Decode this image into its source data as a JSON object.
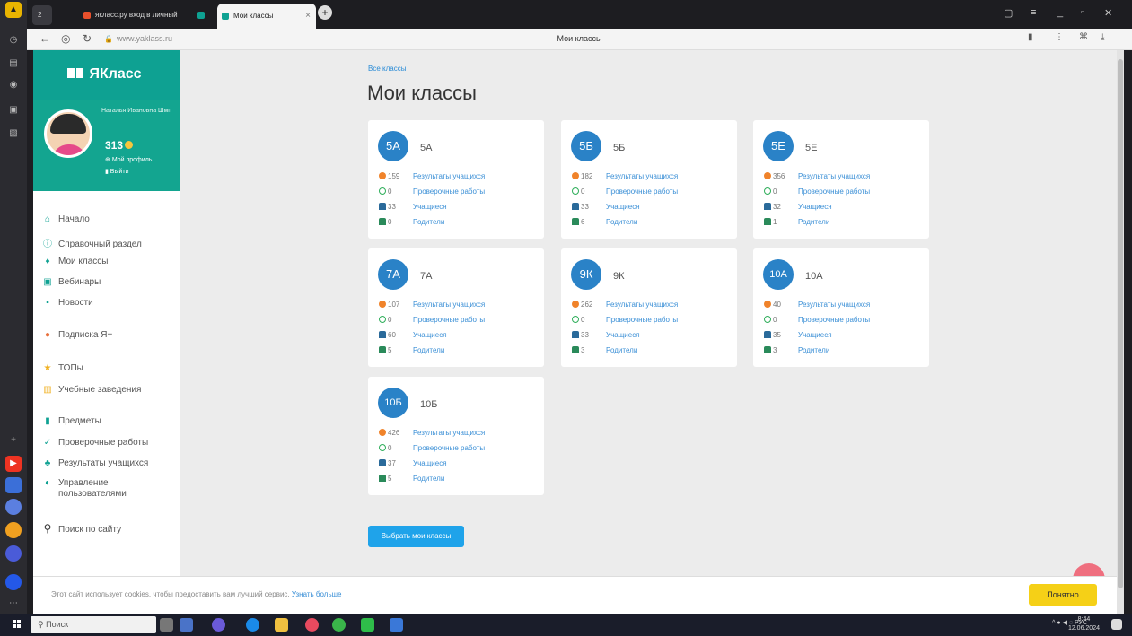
{
  "browser": {
    "tabs": [
      {
        "label": "якласс.ру вход в личный",
        "active": false
      },
      {
        "label": "Мои классы",
        "active": true
      }
    ],
    "url": "www.yaklass.ru",
    "page_title": "Мои классы"
  },
  "site": {
    "logo": "ЯКласс",
    "profile": {
      "name": "Наталья Ивановна Шмп",
      "points": "313",
      "my_profile": "Мой профиль",
      "logout": "Выйти"
    },
    "menu": [
      {
        "label": "Начало",
        "icon": "home-icon"
      },
      {
        "label": "Справочный раздел",
        "icon": "help-icon"
      },
      {
        "label": "Мои классы",
        "icon": "classes-icon"
      },
      {
        "label": "Вебинары",
        "icon": "webinar-icon"
      },
      {
        "label": "Новости",
        "icon": "news-icon"
      },
      {
        "label": "Подписка Я+",
        "icon": "subscription-icon"
      },
      {
        "label": "ТОПы",
        "icon": "star-icon"
      },
      {
        "label": "Учебные заведения",
        "icon": "school-icon"
      },
      {
        "label": "Предметы",
        "icon": "subjects-icon"
      },
      {
        "label": "Проверочные работы",
        "icon": "check-icon"
      },
      {
        "label": "Результаты учащихся",
        "icon": "results-icon"
      },
      {
        "label": "Управление пользователями",
        "icon": "users-icon"
      },
      {
        "label": "Поиск по сайту",
        "icon": "search-icon"
      }
    ]
  },
  "main": {
    "breadcrumb": "Все классы",
    "title": "Мои классы",
    "row_labels": {
      "results": "Результаты учащихся",
      "tests": "Проверочные работы",
      "students": "Учащиеся",
      "parents": "Родители"
    },
    "classes": [
      {
        "badge": "5А",
        "name": "5А",
        "results": "159",
        "tests": "0",
        "students": "33",
        "parents": "0"
      },
      {
        "badge": "5Б",
        "name": "5Б",
        "results": "182",
        "tests": "0",
        "students": "33",
        "parents": "6"
      },
      {
        "badge": "5Е",
        "name": "5Е",
        "results": "356",
        "tests": "0",
        "students": "32",
        "parents": "1"
      },
      {
        "badge": "7А",
        "name": "7А",
        "results": "107",
        "tests": "0",
        "students": "60",
        "parents": "5"
      },
      {
        "badge": "9К",
        "name": "9К",
        "results": "262",
        "tests": "0",
        "students": "33",
        "parents": "3"
      },
      {
        "badge": "10А",
        "name": "10А",
        "results": "40",
        "tests": "0",
        "students": "35",
        "parents": "3"
      },
      {
        "badge": "10Б",
        "name": "10Б",
        "results": "426",
        "tests": "0",
        "students": "37",
        "parents": "5"
      }
    ],
    "choose_button": "Выбрать мои классы"
  },
  "cookie": {
    "message": "Этот сайт использует cookies, чтобы предоставить вам лучший сервис.",
    "more": "Узнать больше",
    "ok": "Понятно"
  },
  "taskbar": {
    "search": "Поиск",
    "lang": "РУС",
    "time": "8:44",
    "date": "12.06.2024"
  },
  "colors": {
    "brand": "#0ea192",
    "badge": "#2a82c7",
    "link": "#3a8fd6",
    "accent_button": "#1fa3ea",
    "cookie_button": "#f5d017"
  }
}
